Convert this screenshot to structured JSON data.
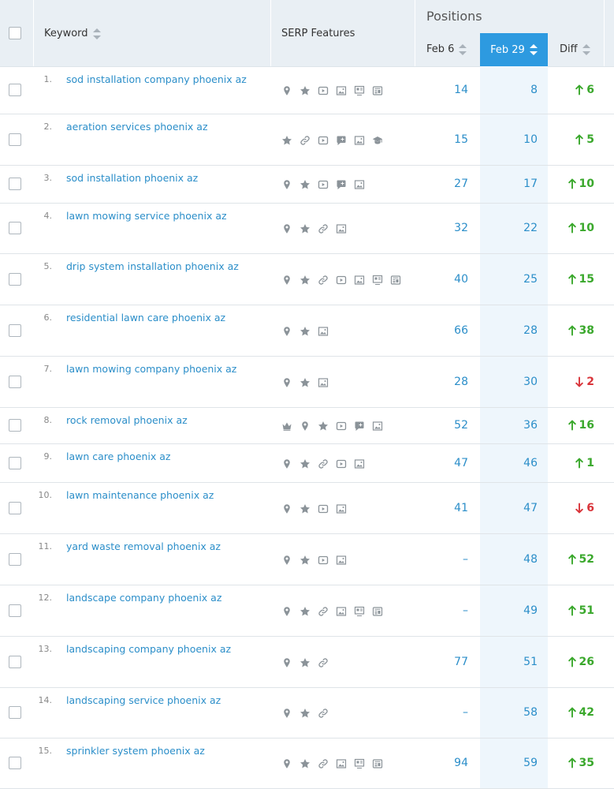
{
  "header": {
    "keyword_label": "Keyword",
    "serp_label": "SERP Features",
    "positions_label": "Positions",
    "feb6_label": "Feb 6",
    "feb29_label": "Feb 29",
    "diff_label": "Diff"
  },
  "colors": {
    "link": "#2b8ec9",
    "up": "#3aa82c",
    "down": "#d9343a",
    "active_header": "#2d9ae0"
  },
  "rows": [
    {
      "num": "1.",
      "keyword": "sod installation company phoenix az",
      "features": [
        "pin-icon",
        "star-icon",
        "video-icon",
        "image-icon",
        "featured-icon",
        "news-icon"
      ],
      "feb6": "14",
      "feb29": "8",
      "dir": "up",
      "diff": "6"
    },
    {
      "num": "2.",
      "keyword": "aeration services phoenix az",
      "features": [
        "star-icon",
        "link-icon",
        "video-icon",
        "review-icon",
        "image-icon",
        "academic-icon"
      ],
      "feb6": "15",
      "feb29": "10",
      "dir": "up",
      "diff": "5"
    },
    {
      "num": "3.",
      "keyword": "sod installation phoenix az",
      "features": [
        "pin-icon",
        "star-icon",
        "video-icon",
        "review-icon",
        "image-icon"
      ],
      "feb6": "27",
      "feb29": "17",
      "dir": "up",
      "diff": "10"
    },
    {
      "num": "4.",
      "keyword": "lawn mowing service phoenix az",
      "features": [
        "pin-icon",
        "star-icon",
        "link-icon",
        "image-icon"
      ],
      "feb6": "32",
      "feb29": "22",
      "dir": "up",
      "diff": "10"
    },
    {
      "num": "5.",
      "keyword": "drip system installation phoenix az",
      "features": [
        "pin-icon",
        "star-icon",
        "link-icon",
        "video-icon",
        "image-icon",
        "featured-icon",
        "news-icon"
      ],
      "feb6": "40",
      "feb29": "25",
      "dir": "up",
      "diff": "15"
    },
    {
      "num": "6.",
      "keyword": "residential lawn care phoenix az",
      "features": [
        "pin-icon",
        "star-icon",
        "image-icon"
      ],
      "feb6": "66",
      "feb29": "28",
      "dir": "up",
      "diff": "38"
    },
    {
      "num": "7.",
      "keyword": "lawn mowing company phoenix az",
      "features": [
        "pin-icon",
        "star-icon",
        "image-icon"
      ],
      "feb6": "28",
      "feb29": "30",
      "dir": "down",
      "diff": "2"
    },
    {
      "num": "8.",
      "keyword": "rock removal phoenix az",
      "features": [
        "crown-icon",
        "pin-icon",
        "star-icon",
        "video-icon",
        "review-icon",
        "image-icon"
      ],
      "feb6": "52",
      "feb29": "36",
      "dir": "up",
      "diff": "16"
    },
    {
      "num": "9.",
      "keyword": "lawn care phoenix az",
      "features": [
        "pin-icon",
        "star-icon",
        "link-icon",
        "video-icon",
        "image-icon"
      ],
      "feb6": "47",
      "feb29": "46",
      "dir": "up",
      "diff": "1"
    },
    {
      "num": "10.",
      "keyword": "lawn maintenance phoenix az",
      "features": [
        "pin-icon",
        "star-icon",
        "video-icon",
        "image-icon"
      ],
      "feb6": "41",
      "feb29": "47",
      "dir": "down",
      "diff": "6"
    },
    {
      "num": "11.",
      "keyword": "yard waste removal phoenix az",
      "features": [
        "pin-icon",
        "star-icon",
        "video-icon",
        "image-icon"
      ],
      "feb6": "–",
      "feb29": "48",
      "dir": "up",
      "diff": "52"
    },
    {
      "num": "12.",
      "keyword": "landscape company phoenix az",
      "features": [
        "pin-icon",
        "star-icon",
        "link-icon",
        "image-icon",
        "featured-icon",
        "news-icon"
      ],
      "feb6": "–",
      "feb29": "49",
      "dir": "up",
      "diff": "51"
    },
    {
      "num": "13.",
      "keyword": "landscaping company phoenix az",
      "features": [
        "pin-icon",
        "star-icon",
        "link-icon"
      ],
      "feb6": "77",
      "feb29": "51",
      "dir": "up",
      "diff": "26"
    },
    {
      "num": "14.",
      "keyword": "landscaping service phoenix az",
      "features": [
        "pin-icon",
        "star-icon",
        "link-icon"
      ],
      "feb6": "–",
      "feb29": "58",
      "dir": "up",
      "diff": "42"
    },
    {
      "num": "15.",
      "keyword": "sprinkler system phoenix az",
      "features": [
        "pin-icon",
        "star-icon",
        "link-icon",
        "image-icon",
        "featured-icon",
        "news-icon"
      ],
      "feb6": "94",
      "feb29": "59",
      "dir": "up",
      "diff": "35"
    }
  ]
}
